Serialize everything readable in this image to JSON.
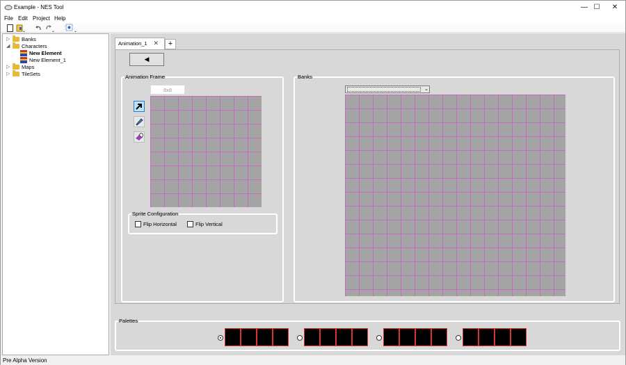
{
  "window": {
    "title": "Example - NES Tool",
    "minimize": "—",
    "maximize": "☐",
    "close": "✕"
  },
  "menu": [
    "File",
    "Edit",
    "Project",
    "Help"
  ],
  "tree": {
    "items": [
      {
        "label": "Banks",
        "type": "folder",
        "expander": "▷"
      },
      {
        "label": "Characters",
        "type": "folder",
        "expander": "◢"
      },
      {
        "label": "New Element",
        "type": "character",
        "bold": true
      },
      {
        "label": "New Element_1",
        "type": "character"
      },
      {
        "label": "Maps",
        "type": "folder",
        "expander": "▷"
      },
      {
        "label": "TileSets",
        "type": "folder",
        "expander": "▷"
      }
    ]
  },
  "status": "Pre Alpha Version",
  "tabs": {
    "active": "Animation_1",
    "close": "✕",
    "add": "+"
  },
  "back_button": "◀",
  "animation_frame": {
    "label": "Animation Frame",
    "size": "8x8"
  },
  "sprite_config": {
    "label": "Sprite Configuration",
    "flip_h": "Flip Horizontal",
    "flip_v": "Flip Vertical"
  },
  "banks": {
    "label": "Banks",
    "arrow": "⌄"
  },
  "palettes": {
    "label": "Palettes",
    "selected": 0,
    "count": 4
  },
  "colors": {
    "grid_bg": "#a4a4a4",
    "grid_line": "#c56bc6",
    "palette_border": "#dd3333"
  },
  "icons": [
    "new-file-icon",
    "open-folder-icon",
    "undo-icon",
    "redo-icon",
    "build-icon",
    "select-arrow-icon",
    "pencil-icon",
    "eraser-icon"
  ]
}
